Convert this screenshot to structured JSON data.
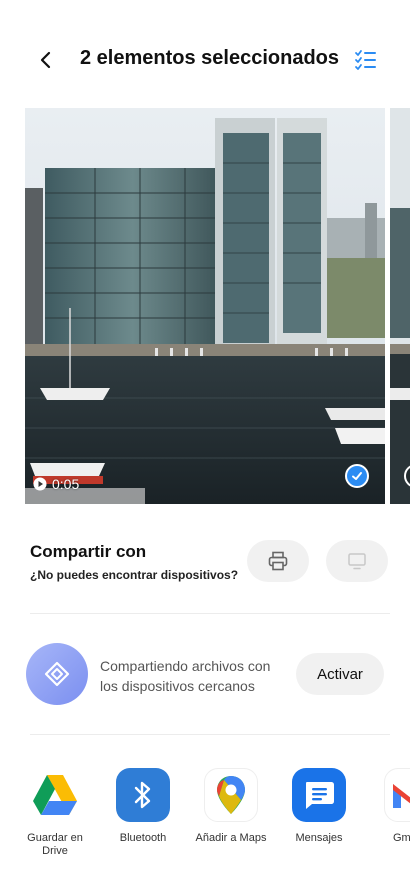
{
  "header": {
    "title": "2 elementos seleccionados"
  },
  "media": {
    "items": [
      {
        "duration": "0:05",
        "selected": true
      },
      {
        "selected": false
      }
    ]
  },
  "share": {
    "title": "Compartir con",
    "subtitle": "¿No puedes encontrar dispositivos?"
  },
  "nearby": {
    "description": "Compartiendo archivos con los dispositivos cercanos",
    "activate_label": "Activar"
  },
  "apps": [
    {
      "label": "Guardar en Drive",
      "icon": "google-drive-icon"
    },
    {
      "label": "Bluetooth",
      "icon": "bluetooth-icon"
    },
    {
      "label": "Añadir a Maps",
      "icon": "google-maps-icon"
    },
    {
      "label": "Mensajes",
      "icon": "messages-icon"
    },
    {
      "label": "Gm",
      "icon": "gmail-icon"
    }
  ],
  "colors": {
    "accent": "#2b8cf3",
    "bluetooth": "#2f7dd6",
    "messages": "#1a73e8"
  }
}
